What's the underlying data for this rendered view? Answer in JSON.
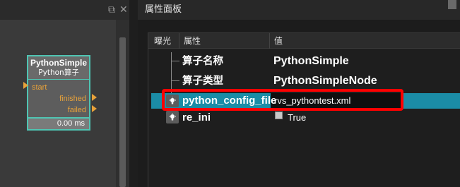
{
  "canvas": {
    "node": {
      "title": "PythonSimple",
      "subtitle": "Python算子",
      "input_port": "start",
      "output_ports": [
        "finished",
        "failed"
      ],
      "duration": "0.00 ms"
    },
    "title_controls": {
      "float_icon": "⧉",
      "close_icon": "✕"
    }
  },
  "property_panel": {
    "title": "属性面板",
    "columns": {
      "expose": "曝光",
      "property": "属性",
      "value": "值"
    },
    "rows": [
      {
        "name": "算子名称",
        "value": "PythonSimple"
      },
      {
        "name": "算子类型",
        "value": "PythonSimpleNode"
      },
      {
        "name": "python_config_file",
        "value": "rvs_pythontest.xml",
        "selected": true
      },
      {
        "name": "re_ini",
        "value": "True",
        "checkbox": true
      }
    ]
  },
  "colors": {
    "accent_teal": "#4fc5b3",
    "port_orange": "#e8a23a",
    "selection_blue": "#1b8ca6",
    "highlight_red": "#ff0000"
  }
}
